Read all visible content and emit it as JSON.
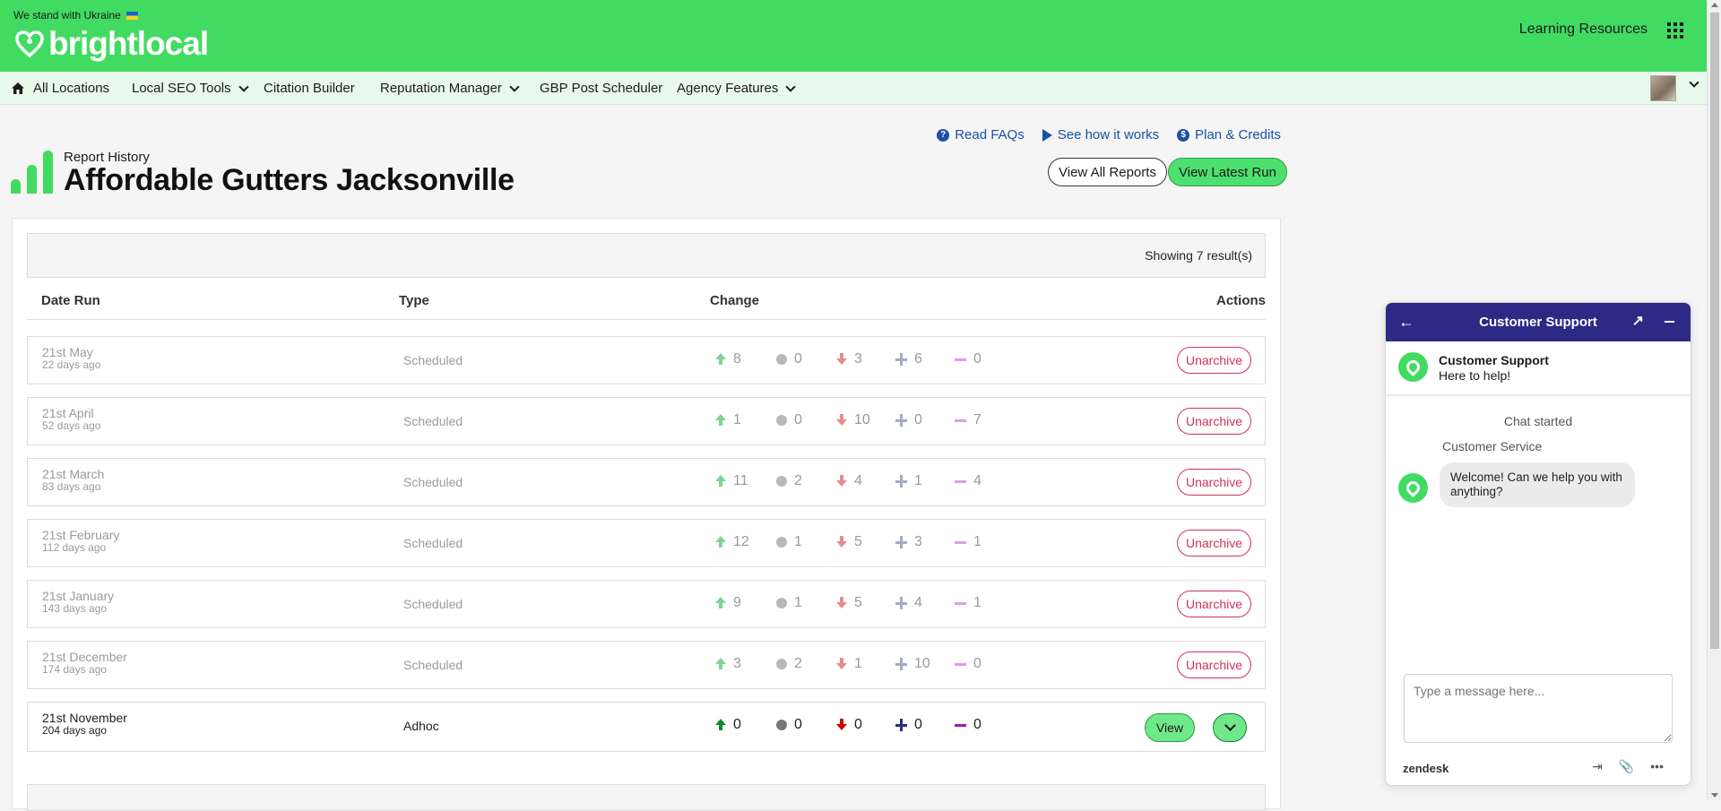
{
  "banner": {
    "text": "We stand with Ukraine"
  },
  "brand": {
    "name": "brightlocal",
    "green": "#41db62"
  },
  "top_right": {
    "learning_label": "Learning Resources",
    "apps_icon": "grid-icon"
  },
  "nav": {
    "items": [
      {
        "label": "All Locations",
        "icon": "home-icon"
      },
      {
        "label": "Local SEO Tools",
        "dropdown": true
      },
      {
        "label": "Citation Builder"
      },
      {
        "label": "Reputation Manager",
        "dropdown": true
      },
      {
        "label": "GBP Post Scheduler"
      },
      {
        "label": "Agency Features",
        "dropdown": true
      }
    ]
  },
  "header": {
    "subtitle": "Report History",
    "title": "Affordable Gutters Jacksonville",
    "help_links": [
      {
        "label": "Read FAQs",
        "icon": "question-icon"
      },
      {
        "label": "See how it works",
        "icon": "play-icon"
      },
      {
        "label": "Plan & Credits",
        "icon": "dollar-icon"
      }
    ],
    "view_all_label": "View All Reports",
    "view_latest_label": "View Latest Run"
  },
  "table": {
    "showing": "Showing 7 result(s)",
    "columns": [
      "Date Run",
      "Type",
      "Change",
      "Actions"
    ],
    "rows": [
      {
        "date": "21st May",
        "ago": "22 days ago",
        "type": "Scheduled",
        "up": "8",
        "same": "0",
        "down": "3",
        "new": "6",
        "lost": "0",
        "action": "Unarchive",
        "archived": true
      },
      {
        "date": "21st April",
        "ago": "52 days ago",
        "type": "Scheduled",
        "up": "1",
        "same": "0",
        "down": "10",
        "new": "0",
        "lost": "7",
        "action": "Unarchive",
        "archived": true
      },
      {
        "date": "21st March",
        "ago": "83 days ago",
        "type": "Scheduled",
        "up": "11",
        "same": "2",
        "down": "4",
        "new": "1",
        "lost": "4",
        "action": "Unarchive",
        "archived": true
      },
      {
        "date": "21st February",
        "ago": "112 days ago",
        "type": "Scheduled",
        "up": "12",
        "same": "1",
        "down": "5",
        "new": "3",
        "lost": "1",
        "action": "Unarchive",
        "archived": true
      },
      {
        "date": "21st January",
        "ago": "143 days ago",
        "type": "Scheduled",
        "up": "9",
        "same": "1",
        "down": "5",
        "new": "4",
        "lost": "1",
        "action": "Unarchive",
        "archived": true
      },
      {
        "date": "21st December",
        "ago": "174 days ago",
        "type": "Scheduled",
        "up": "3",
        "same": "2",
        "down": "1",
        "new": "10",
        "lost": "0",
        "action": "Unarchive",
        "archived": true
      },
      {
        "date": "21st November",
        "ago": "204 days ago",
        "type": "Adhoc",
        "up": "0",
        "same": "0",
        "down": "0",
        "new": "0",
        "lost": "0",
        "action": "View",
        "archived": false
      }
    ]
  },
  "chat": {
    "header_title": "Customer Support",
    "agent_name": "Customer Support",
    "agent_sub": "Here to help!",
    "started": "Chat started",
    "service_label": "Customer Service",
    "message": "Welcome! Can we help you with anything?",
    "input_placeholder": "Type a message here...",
    "footer_brand": "zendesk",
    "header_color": "#2d2a86"
  }
}
